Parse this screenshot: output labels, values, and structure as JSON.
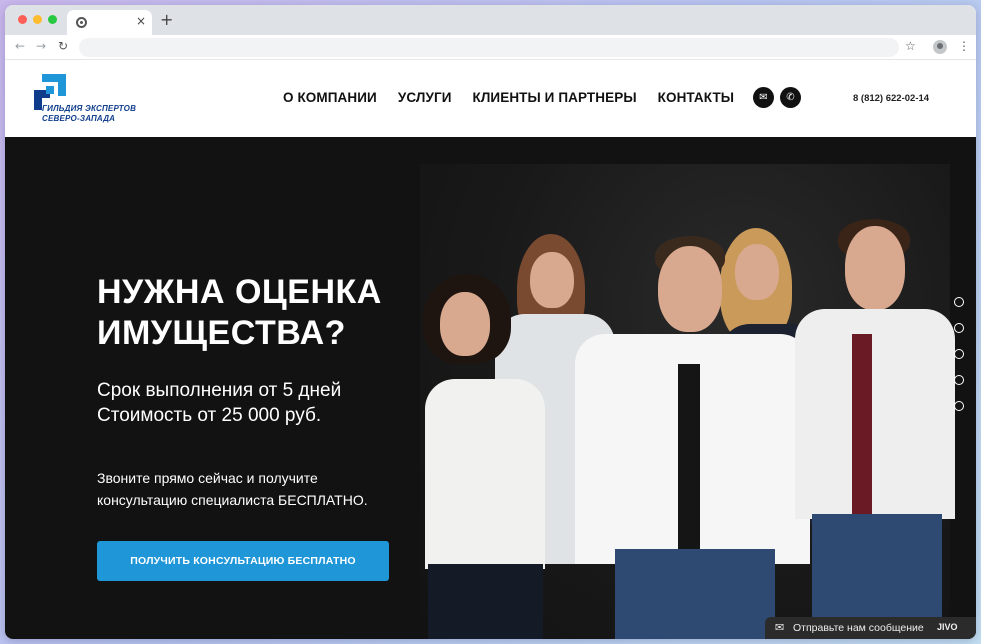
{
  "browser": {
    "tab_close": "×",
    "new_tab": "+",
    "back_icon": "←",
    "forward_icon": "→",
    "reload_icon": "↻",
    "star_icon": "☆",
    "menu_icon": "⋮",
    "traffic_lights": [
      "#ff5f57",
      "#febc2e",
      "#28c840"
    ]
  },
  "header": {
    "logo_line1": "ГИЛЬДИЯ ЭКСПЕРТОВ",
    "logo_line2": "СЕВЕРО-ЗАПАДА",
    "menu": [
      {
        "label": "О КОМПАНИИ"
      },
      {
        "label": "УСЛУГИ"
      },
      {
        "label": "КЛИЕНТЫ И ПАРТНЕРЫ"
      },
      {
        "label": "КОНТАКТЫ"
      }
    ],
    "mail_icon": "✉",
    "phone_icon": "✆",
    "phone": "8 (812) 622-02-14"
  },
  "hero": {
    "title_line1": "НУЖНА ОЦЕНКА",
    "title_line2": "ИМУЩЕСТВА?",
    "sub_line1": "Срок выполнения от 5 дней",
    "sub_line2": "Стоимость от 25 000 руб.",
    "cta_line1": "Звоните прямо сейчас и получите",
    "cta_line2": "консультацию специалиста БЕСПЛАТНО.",
    "button": "ПОЛУЧИТЬ КОНСУЛЬТАЦИЮ БЕСПЛАТНО",
    "slides_count": 5
  },
  "chat": {
    "icon": "✉",
    "label": "Отправьте нам сообщение",
    "brand": "JIVO"
  },
  "colors": {
    "accent": "#1f96d8",
    "logo": "#0f3d8c",
    "hero_bg": "#121212"
  }
}
